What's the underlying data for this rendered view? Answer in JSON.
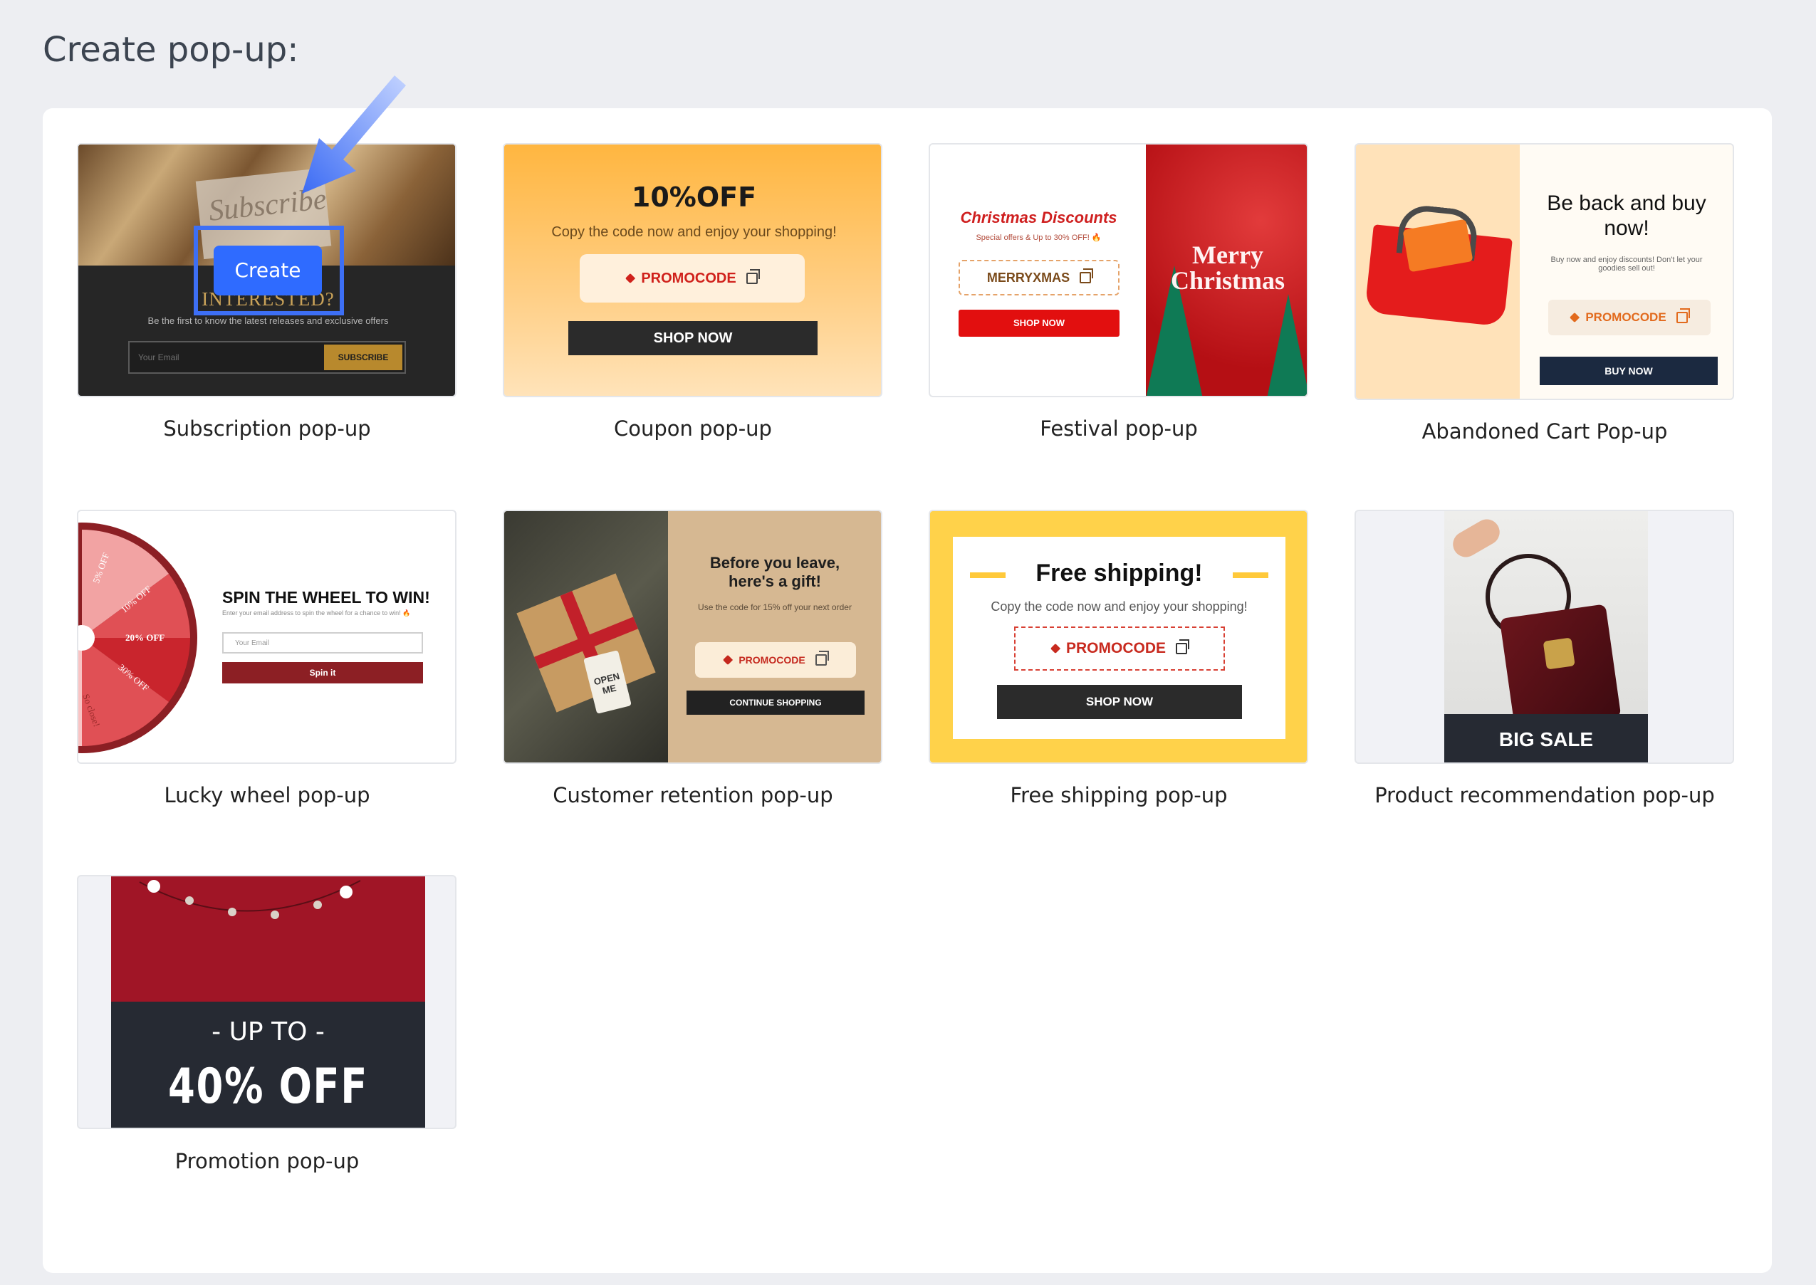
{
  "page": {
    "title": "Create pop-up:"
  },
  "cards": [
    {
      "label": "Subscription pop-up",
      "create_label": "Create",
      "hero_text": "Subscribe",
      "headline": "INTERESTED?",
      "subtitle": "Be the first to know the latest releases and exclusive offers",
      "email_placeholder": "Your Email",
      "button": "SUBSCRIBE"
    },
    {
      "label": "Coupon pop-up",
      "title": "10%OFF",
      "subtitle": "Copy the code now and enjoy your shopping!",
      "code": "PROMOCODE",
      "button": "SHOP NOW"
    },
    {
      "label": "Festival pop-up",
      "title": "Christmas Discounts",
      "subtitle": "Special offers & Up to 30% OFF! 🔥",
      "code": "MERRYXMAS",
      "button": "SHOP NOW",
      "image_text_1": "Merry",
      "image_text_2": "Christmas"
    },
    {
      "label": "Abandoned Cart Pop-up",
      "title": "Be back and buy now!",
      "subtitle": "Buy now and enjoy discounts! Don't let your goodies sell out!",
      "code": "PROMOCODE",
      "button": "BUY NOW"
    },
    {
      "label": "Lucky wheel pop-up",
      "title": "SPIN THE WHEEL TO WIN!",
      "subtitle": "Enter your email address to spin the wheel for a chance to win! 🔥",
      "email_placeholder": "Your Email",
      "button": "Spin it",
      "wheel_labels": [
        "5% OFF",
        "10% OFF",
        "20% OFF",
        "30% OFF",
        "So close!"
      ]
    },
    {
      "label": "Customer retention pop-up",
      "title": "Before you leave, here's a gift!",
      "subtitle": "Use the code for 15% off your next order",
      "code": "PROMOCODE",
      "button": "CONTINUE SHOPPING",
      "tag_text": "OPEN ME"
    },
    {
      "label": "Free shipping pop-up",
      "title": "Free shipping!",
      "subtitle": "Copy the code now and enjoy your shopping!",
      "code": "PROMOCODE",
      "button": "SHOP NOW"
    },
    {
      "label": "Product recommendation pop-up",
      "banner": "BIG SALE"
    },
    {
      "label": "Promotion pop-up",
      "line1": "- UP TO -",
      "line2": "40% OFF"
    }
  ],
  "colors": {
    "accent_blue": "#3d6ff5",
    "create_blue": "#2f6bff",
    "coupon_red": "#d0211b",
    "dark": "#262a33",
    "gold": "#b8892d",
    "navy": "#1b2940",
    "yellow": "#ffd24a"
  },
  "icons": {
    "arrow": "arrow-down-left-icon",
    "copy": "copy-icon",
    "tag": "tag-icon"
  }
}
